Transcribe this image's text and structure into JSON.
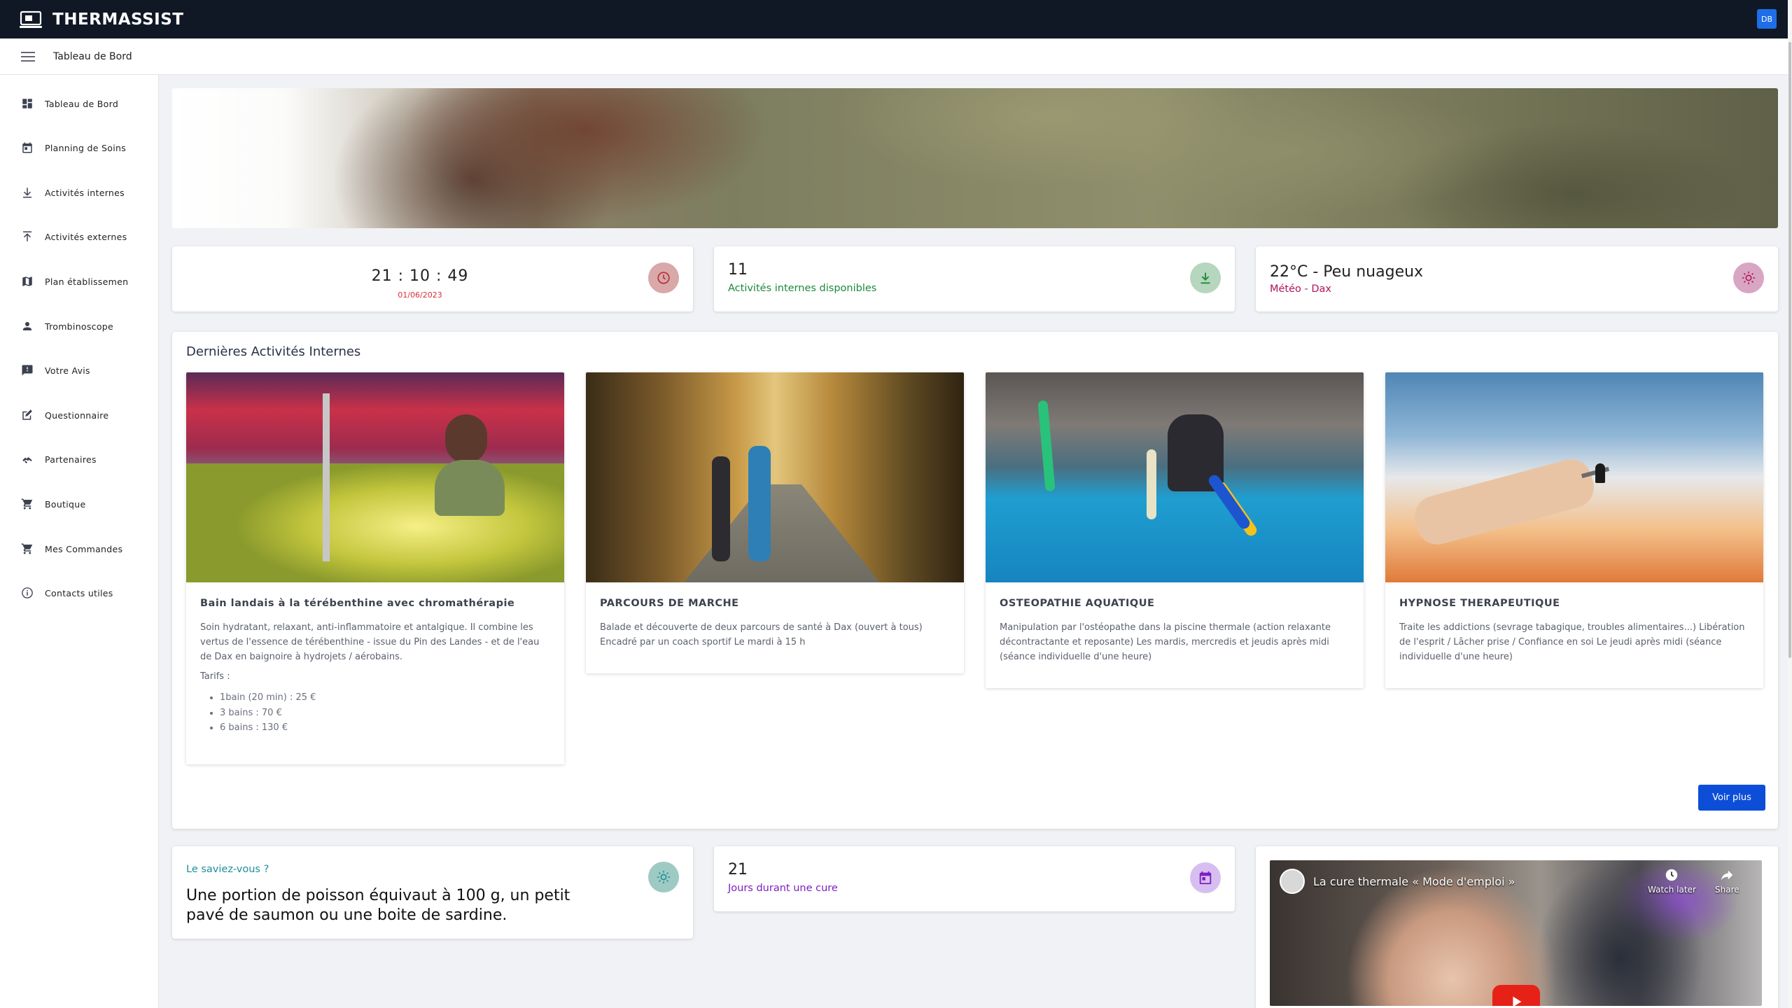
{
  "app": {
    "title": "THERMASSIST",
    "user_initials": "DB"
  },
  "header": {
    "breadcrumb": "Tableau de Bord"
  },
  "sidebar": {
    "items": [
      {
        "label": "Tableau de Bord",
        "icon": "dashboard-icon"
      },
      {
        "label": "Planning de Soins",
        "icon": "calendar-icon"
      },
      {
        "label": "Activités internes",
        "icon": "download-icon"
      },
      {
        "label": "Activités externes",
        "icon": "upload-icon"
      },
      {
        "label": "Plan établissemen",
        "icon": "map-icon"
      },
      {
        "label": "Trombinoscope",
        "icon": "person-icon"
      },
      {
        "label": "Votre Avis",
        "icon": "feedback-icon"
      },
      {
        "label": "Questionnaire",
        "icon": "edit-icon"
      },
      {
        "label": "Partenaires",
        "icon": "handshake-icon"
      },
      {
        "label": "Boutique",
        "icon": "cart-icon"
      },
      {
        "label": "Mes Commandes",
        "icon": "cart-icon"
      },
      {
        "label": "Contacts utiles",
        "icon": "info-icon"
      }
    ]
  },
  "stats": {
    "clock": {
      "h": "21",
      "m": "10",
      "s": "49",
      "sep": ":",
      "date": "01/06/2023",
      "color": "#d1313c"
    },
    "internal": {
      "value": "11",
      "label": "Activités internes disponibles",
      "color": "#1d8a3a"
    },
    "weather": {
      "value": "22°C - Peu nuageux",
      "label": "Météo - Dax",
      "color": "#b0145a"
    }
  },
  "activities": {
    "title": "Dernières Activités Internes",
    "items": [
      {
        "title": "Bain landais à la térébenthine avec chromathérapie",
        "description": "Soin hydratant, relaxant, anti-inflammatoire et antalgique. Il combine les vertus de l'essence de térébenthine - issue du Pin des Landes - et de l'eau de Dax en baignoire à hydrojets / aérobains.",
        "tarifs_label": "Tarifs :",
        "prices": [
          "1bain (20 min) : 25 €",
          "3 bains : 70 €",
          "6 bains : 130 €"
        ]
      },
      {
        "title": "PARCOURS DE MARCHE",
        "description": "Balade et découverte de deux parcours de santé à Dax (ouvert à tous) Encadré par un coach sportif Le mardi à 15 h"
      },
      {
        "title": "OSTEOPATHIE AQUATIQUE",
        "description": "Manipulation par l'ostéopathe dans la piscine thermale (action relaxante décontractante et reposante) Les mardis, mercredis et jeudis après midi (séance individuelle d'une heure)"
      },
      {
        "title": "HYPNOSE THERAPEUTIQUE",
        "description": "Traite les addictions (sevrage tabagique, troubles alimentaires...) Libération de l'esprit / Lâcher prise / Confiance en soi Le jeudi après midi (séance individuelle d'une heure)"
      }
    ],
    "more_label": "Voir plus"
  },
  "did_you_know": {
    "label": "Le saviez-vous ?",
    "text": "Une portion de poisson équivaut à 100 g, un petit pavé de saumon ou une boite de sardine.",
    "color": "#1b8e9e"
  },
  "cure": {
    "value": "21",
    "label": "Jours durant une cure",
    "color": "#7e1ec0"
  },
  "video": {
    "title": "La cure thermale « Mode d'emploi »",
    "watch_later": "Watch later",
    "share": "Share"
  }
}
